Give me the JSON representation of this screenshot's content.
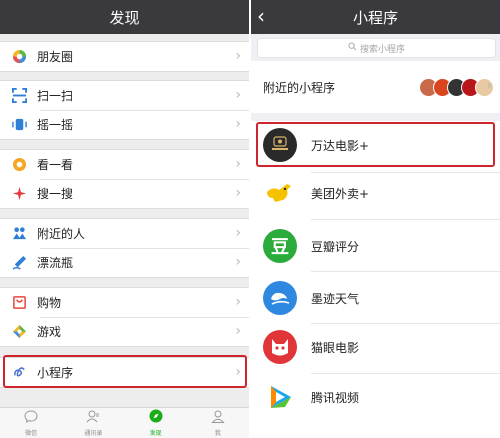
{
  "left": {
    "header_title": "发现",
    "items": [
      {
        "label": "朋友圈",
        "icon": "moments-icon"
      },
      {
        "label": "扫一扫",
        "icon": "scan-icon"
      },
      {
        "label": "摇一摇",
        "icon": "shake-icon"
      },
      {
        "label": "看一看",
        "icon": "top-stories-icon"
      },
      {
        "label": "搜一搜",
        "icon": "search-icon"
      },
      {
        "label": "附近的人",
        "icon": "people-nearby-icon"
      },
      {
        "label": "漂流瓶",
        "icon": "drift-bottle-icon"
      },
      {
        "label": "购物",
        "icon": "shopping-icon"
      },
      {
        "label": "游戏",
        "icon": "games-icon"
      },
      {
        "label": "小程序",
        "icon": "mini-program-icon"
      }
    ],
    "tabs": [
      {
        "label": "微信",
        "icon": "chat-icon"
      },
      {
        "label": "通讯录",
        "icon": "contacts-icon"
      },
      {
        "label": "发现",
        "icon": "discover-icon",
        "active": true
      },
      {
        "label": "我",
        "icon": "me-icon"
      }
    ]
  },
  "right": {
    "header_title": "小程序",
    "search_placeholder": "搜索小程序",
    "nearby_label": "附近的小程序",
    "apps": [
      {
        "label": "万达电影+",
        "icon": "wanda-icon"
      },
      {
        "label": "美团外卖+",
        "icon": "meituan-icon"
      },
      {
        "label": "豆瓣评分",
        "icon": "douban-icon",
        "glyph": "豆"
      },
      {
        "label": "墨迹天气",
        "icon": "moji-weather-icon"
      },
      {
        "label": "猫眼电影",
        "icon": "maoyan-icon"
      },
      {
        "label": "腾讯视频",
        "icon": "tencent-video-icon"
      }
    ]
  },
  "colors": {
    "header": "#3a393e",
    "highlight": "#d0242c",
    "accent": "#1aad19"
  }
}
